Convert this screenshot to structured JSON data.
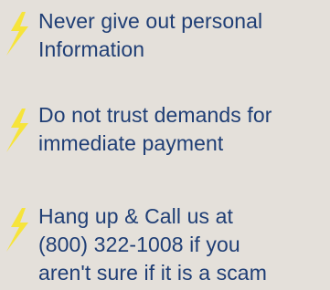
{
  "accent_color": "#f6e43b",
  "text_color": "#1f3e75",
  "background_color": "#e4e0da",
  "icon": "lightning-bolt-icon",
  "tips": [
    {
      "lines": [
        "Never give out personal",
        "Information"
      ]
    },
    {
      "lines": [
        "Do not trust demands for",
        "immediate payment"
      ]
    },
    {
      "lines": [
        "Hang up & Call us at",
        "(800) 322-1008 if you",
        "aren't sure if it is a scam"
      ]
    }
  ]
}
